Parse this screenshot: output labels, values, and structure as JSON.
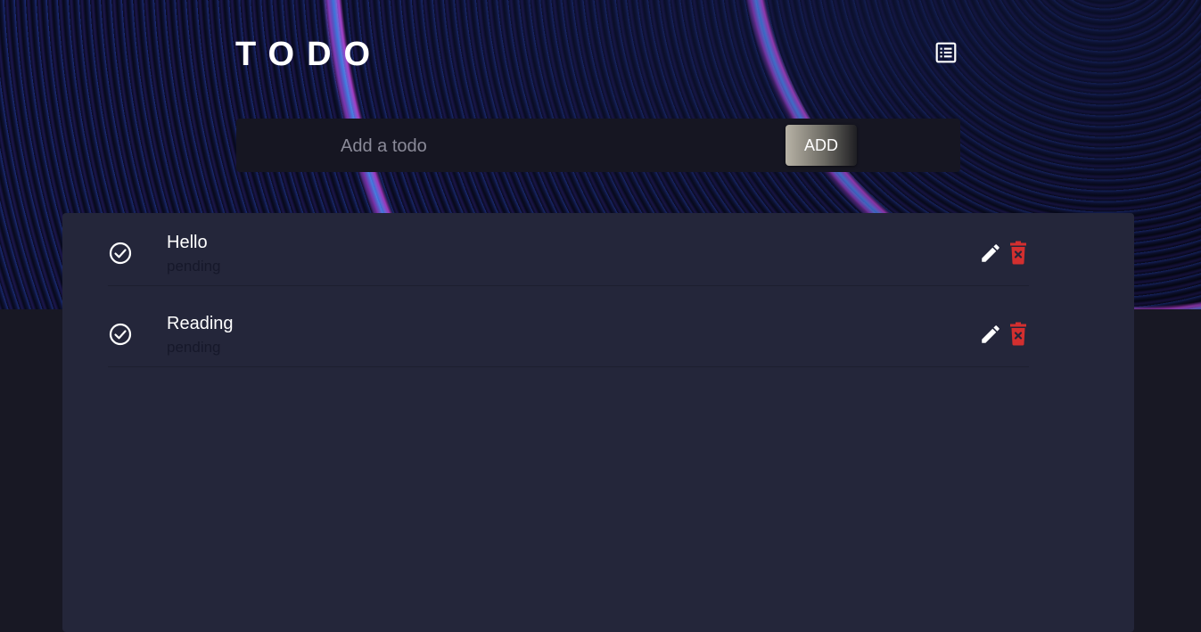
{
  "app": {
    "title": "TODO"
  },
  "add_form": {
    "placeholder": "Add a todo",
    "value": "",
    "button_label": "ADD"
  },
  "todos": [
    {
      "title": "Hello",
      "status": "pending"
    },
    {
      "title": "Reading",
      "status": "pending"
    }
  ],
  "icons": {
    "theme_toggle": "list-icon",
    "complete": "check-circle-icon",
    "edit": "pencil-icon",
    "delete": "trash-icon"
  },
  "colors": {
    "page_background": "#181824",
    "panel_background": "#24263a",
    "input_bar_background": "#161622",
    "delete_red": "#d32f2f",
    "text_primary": "#ffffff"
  }
}
